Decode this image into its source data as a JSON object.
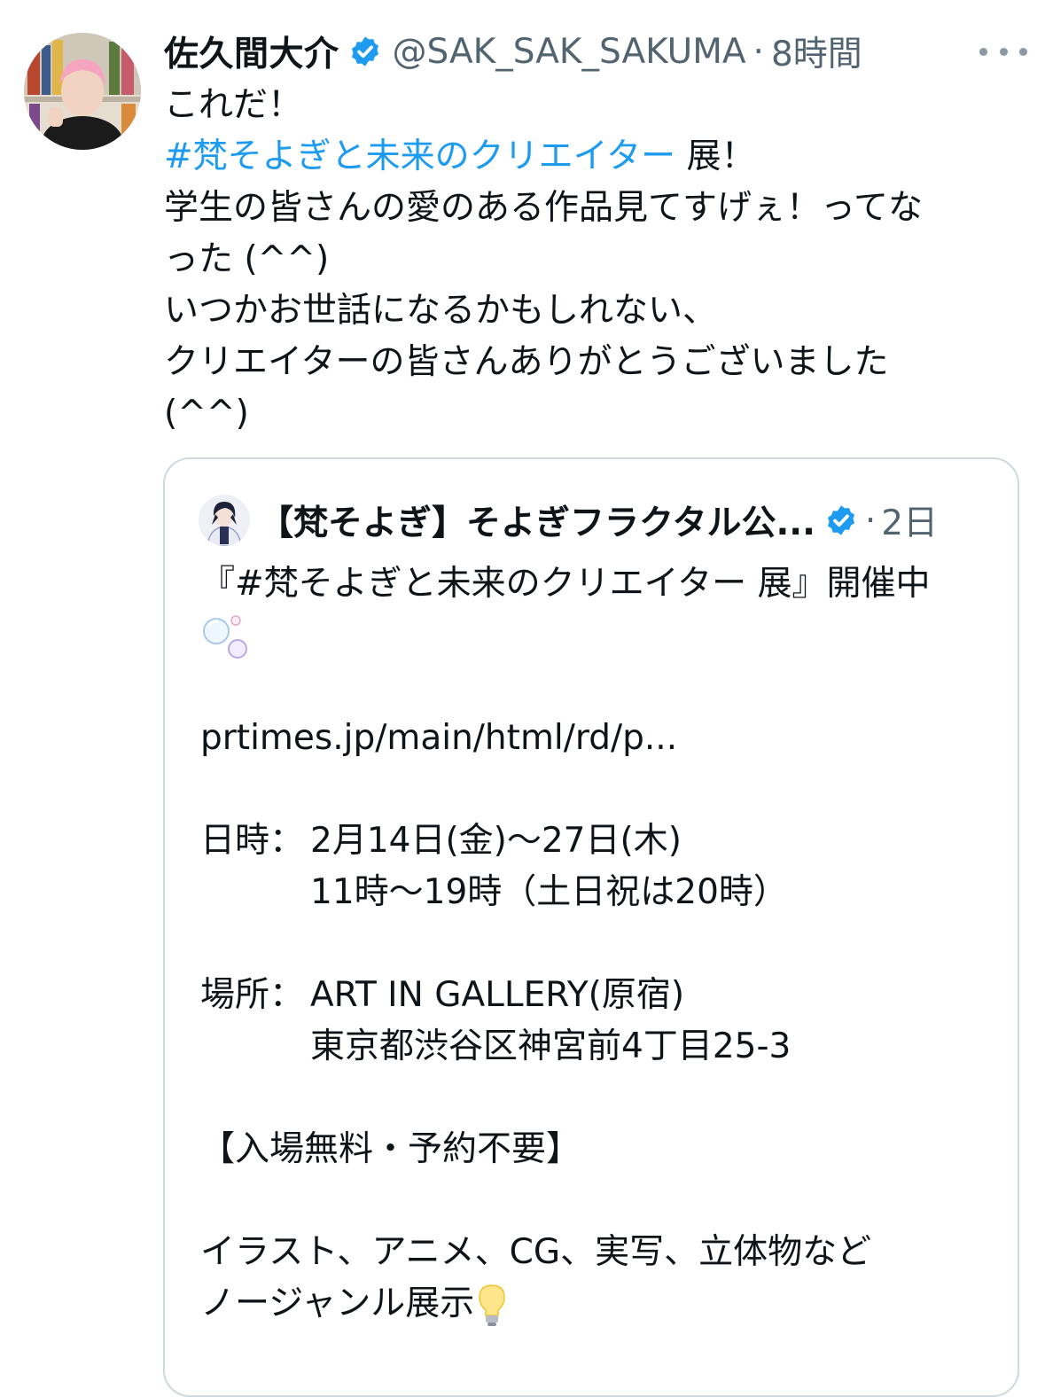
{
  "tweet": {
    "display_name": "佐久間大介",
    "handle": "@SAK_SAK_SAKUMA",
    "separator": "·",
    "time": "8時間",
    "lines": [
      {
        "text": "これだ！"
      },
      {
        "hashtag": "#梵そよぎと未来のクリエイター",
        "text": " 展！"
      },
      {
        "text": "学生の皆さんの愛のある作品見てすげぇ！ってな"
      },
      {
        "text": "った (^^)"
      },
      {
        "text": "いつかお世話になるかもしれない、"
      },
      {
        "text": "クリエイターの皆さんありがとうございました"
      },
      {
        "text": "(^^)"
      }
    ]
  },
  "quote": {
    "display_name": "【梵そよぎ】そよぎフラクタル公...",
    "separator": "·",
    "time": "2日",
    "line1": "『#梵そよぎと未来のクリエイター 展』開催中",
    "link": "prtimes.jp/main/html/rd/p...",
    "date_label": "日時：",
    "date_value": "2月14日(金)〜27日(木)",
    "hours": "11時〜19時（土日祝は20時）",
    "place_label": "場所：",
    "place_value": "ART IN GALLERY(原宿)",
    "address": "東京都渋谷区神宮前4丁目25-3",
    "notice": "【入場無料・予約不要】",
    "genres": "イラスト、アニメ、CG、実写、立体物など",
    "genre_line2": "ノージャンル展示"
  },
  "icons": {
    "verified": "verified-badge-icon",
    "more": "more-icon",
    "bubbles": "bubbles-emoji",
    "bulb": "light-bulb-emoji"
  },
  "colors": {
    "hashtag": "#1d9bf0",
    "verified": "#1d9bf0",
    "secondary_text": "#536471",
    "border": "#cfd9de"
  }
}
